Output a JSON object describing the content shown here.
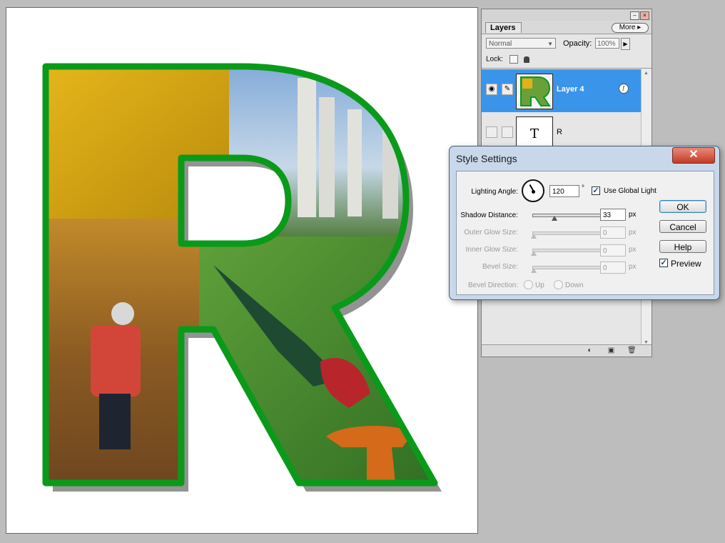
{
  "layers_panel": {
    "tab_label": "Layers",
    "more_label": "More",
    "blend_mode": "Normal",
    "opacity_label": "Opacity:",
    "opacity_value": "100%",
    "lock_label": "Lock:",
    "layers": [
      {
        "name": "Layer 4",
        "selected": true
      },
      {
        "name": "R",
        "selected": false,
        "thumb_text": "T"
      }
    ]
  },
  "dialog": {
    "title": "Style Settings",
    "lighting_angle_label": "Lighting Angle:",
    "lighting_angle_value": "120",
    "degree_symbol": "°",
    "use_global_light_label": "Use Global Light",
    "use_global_light_checked": true,
    "shadow_distance_label": "Shadow Distance:",
    "shadow_distance_value": "33",
    "outer_glow_label": "Outer Glow Size:",
    "outer_glow_value": "0",
    "inner_glow_label": "Inner Glow Size:",
    "inner_glow_value": "0",
    "bevel_size_label": "Bevel Size:",
    "bevel_size_value": "0",
    "bevel_direction_label": "Bevel Direction:",
    "up_label": "Up",
    "down_label": "Down",
    "unit": "px",
    "ok_label": "OK",
    "cancel_label": "Cancel",
    "help_label": "Help",
    "preview_label": "Preview",
    "preview_checked": true
  },
  "colors": {
    "outline_green": "#0a9a1a",
    "selection_blue": "#3a95ea"
  }
}
